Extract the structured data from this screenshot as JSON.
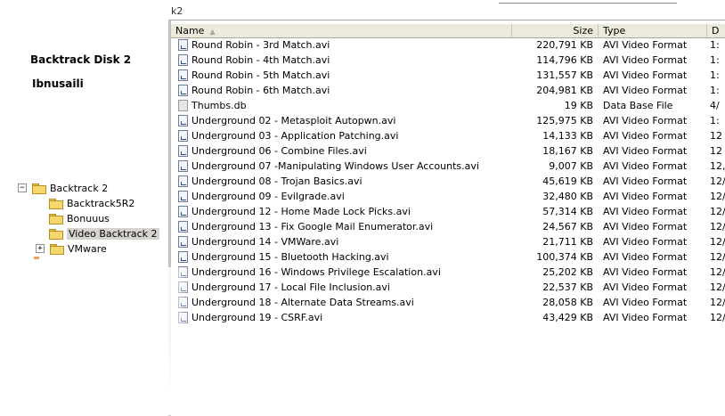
{
  "breadcrumb": "k2",
  "labels": {
    "title": "Backtrack Disk 2",
    "author": "Ibnusaili"
  },
  "tree": {
    "items": [
      {
        "label": "Backtrack 2",
        "expander": "−",
        "level": 0
      },
      {
        "label": "Backtrack5R2",
        "level": 1
      },
      {
        "label": "Bonuuus",
        "level": 1
      },
      {
        "label": "Video Backtrack 2",
        "level": 1,
        "selected": true
      },
      {
        "label": "VMware",
        "expander": "+",
        "level": 1
      }
    ]
  },
  "columns": {
    "name": "Name",
    "size": "Size",
    "type": "Type",
    "date": "D"
  },
  "files": [
    {
      "name": "Round Robin - 3rd Match.avi",
      "size": "220,791 KB",
      "type": "AVI Video Format",
      "date": "1:",
      "icon": "video-file-icon"
    },
    {
      "name": "Round Robin - 4th Match.avi",
      "size": "114,796 KB",
      "type": "AVI Video Format",
      "date": "1:",
      "icon": "video-file-icon"
    },
    {
      "name": "Round Robin - 5th Match.avi",
      "size": "131,557 KB",
      "type": "AVI Video Format",
      "date": "1:",
      "icon": "video-file-icon"
    },
    {
      "name": "Round Robin - 6th Match.avi",
      "size": "204,981 KB",
      "type": "AVI Video Format",
      "date": "1:",
      "icon": "video-file-icon"
    },
    {
      "name": "Thumbs.db",
      "size": "19 KB",
      "type": "Data Base File",
      "date": "4/",
      "icon": "database-file-icon"
    },
    {
      "name": "Underground 02 - Metasploit Autopwn.avi",
      "size": "125,975 KB",
      "type": "AVI Video Format",
      "date": "1:",
      "icon": "video-file-icon"
    },
    {
      "name": "Underground 03 - Application Patching.avi",
      "size": "14,133 KB",
      "type": "AVI Video Format",
      "date": "12",
      "icon": "video-file-icon"
    },
    {
      "name": "Underground 06 - Combine Files.avi",
      "size": "18,167 KB",
      "type": "AVI Video Format",
      "date": "12",
      "icon": "video-file-icon"
    },
    {
      "name": "Underground 07 -Manipulating Windows User Accounts.avi",
      "size": "9,007 KB",
      "type": "AVI Video Format",
      "date": "12,",
      "icon": "video-file-icon"
    },
    {
      "name": "Underground 08 - Trojan Basics.avi",
      "size": "45,619 KB",
      "type": "AVI Video Format",
      "date": "12/",
      "icon": "video-file-icon"
    },
    {
      "name": "Underground 09 - Evilgrade.avi",
      "size": "32,480 KB",
      "type": "AVI Video Format",
      "date": "12/",
      "icon": "video-file-icon"
    },
    {
      "name": "Underground 12 - Home Made Lock Picks.avi",
      "size": "57,314 KB",
      "type": "AVI Video Format",
      "date": "12/:",
      "icon": "video-file-icon"
    },
    {
      "name": "Underground 13 - Fix Google Mail Enumerator.avi",
      "size": "24,567 KB",
      "type": "AVI Video Format",
      "date": "12/:",
      "icon": "video-file-icon"
    },
    {
      "name": "Underground 14 - VMWare.avi",
      "size": "21,711 KB",
      "type": "AVI Video Format",
      "date": "12/:",
      "icon": "video-file-icon"
    },
    {
      "name": "Underground 15 - Bluetooth Hacking.avi",
      "size": "100,374 KB",
      "type": "AVI Video Format",
      "date": "12/:",
      "icon": "video-file-icon"
    },
    {
      "name": "Underground 16 - Windows Privilege Escalation.avi",
      "size": "25,202 KB",
      "type": "AVI Video Format",
      "date": "12/:",
      "icon": "video-file-icon"
    },
    {
      "name": "Underground 17 - Local File Inclusion.avi",
      "size": "22,537 KB",
      "type": "AVI Video Format",
      "date": "12/:",
      "icon": "video-file-icon"
    },
    {
      "name": "Underground 18 - Alternate Data Streams.avi",
      "size": "28,058 KB",
      "type": "AVI Video Format",
      "date": "12/",
      "icon": "video-file-icon"
    },
    {
      "name": "Underground 19 - CSRF.avi",
      "size": "43,429 KB",
      "type": "AVI Video Format",
      "date": "12/",
      "icon": "video-file-icon"
    }
  ]
}
